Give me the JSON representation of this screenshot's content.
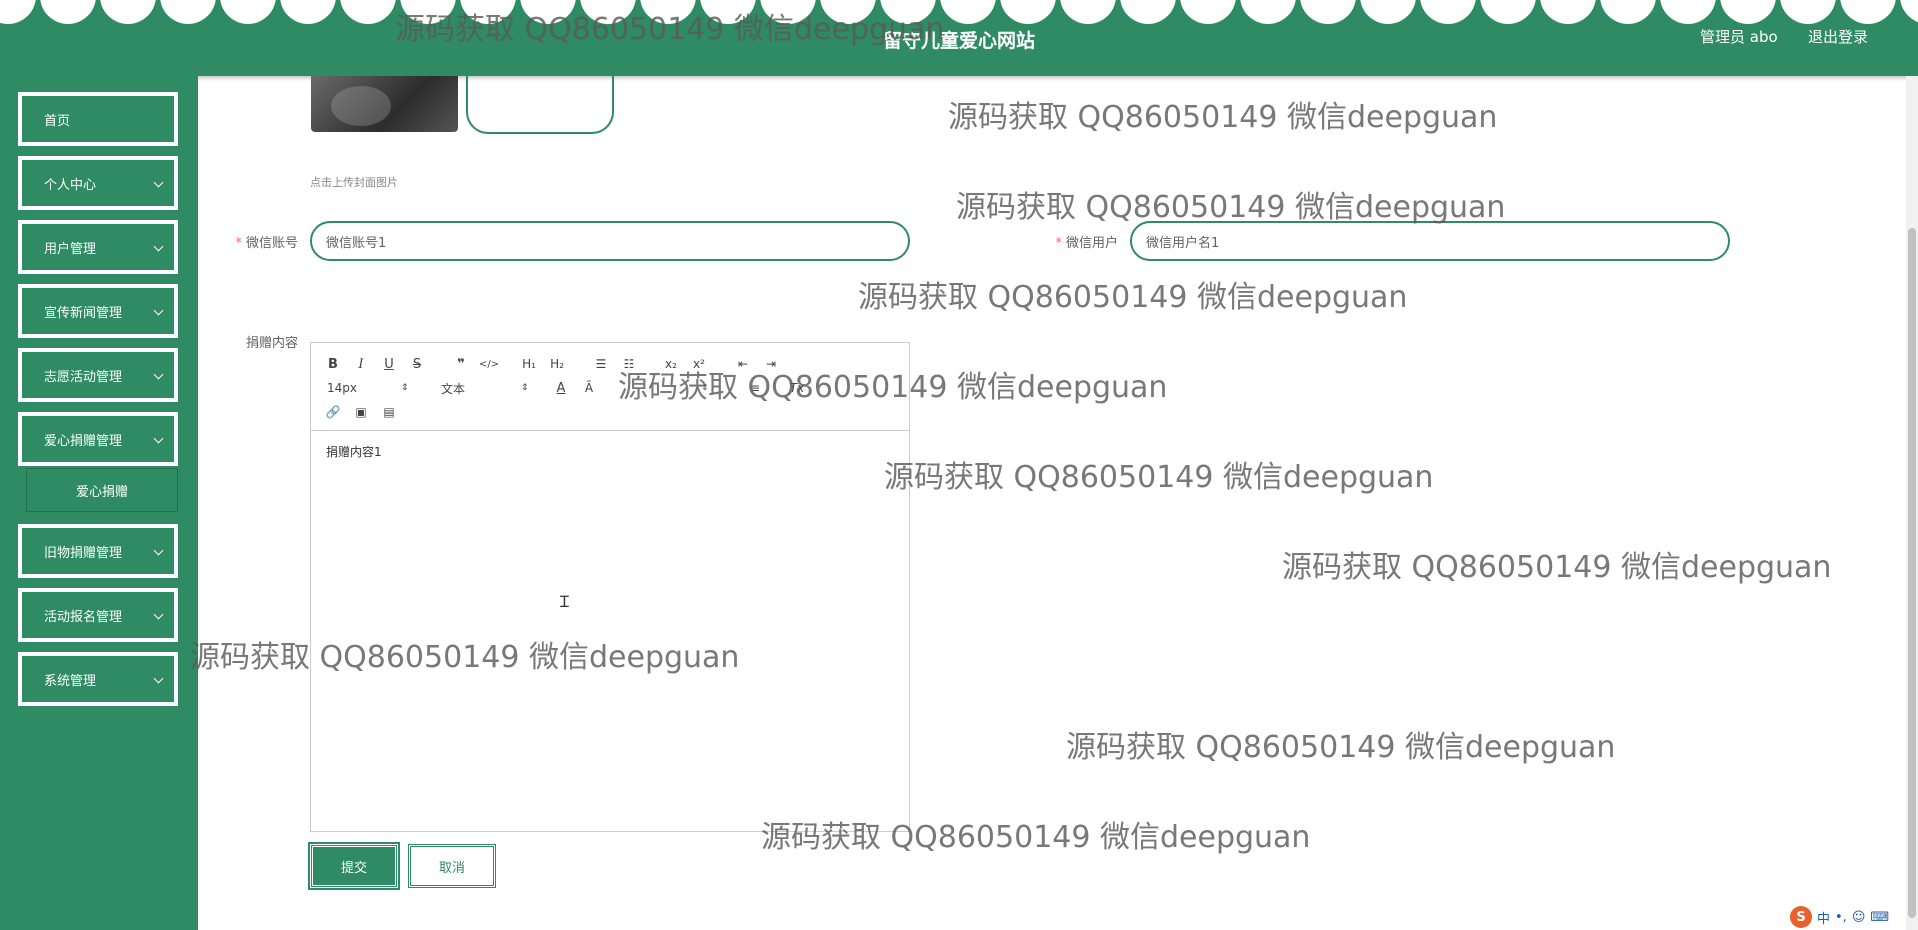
{
  "header": {
    "site_title": "留守儿童爱心网站",
    "user_label": "管理员 abo",
    "logout_label": "退出登录"
  },
  "sidebar": {
    "items": [
      {
        "label": "首页",
        "has_arrow": false
      },
      {
        "label": "个人中心",
        "has_arrow": true
      },
      {
        "label": "用户管理",
        "has_arrow": true
      },
      {
        "label": "宣传新闻管理",
        "has_arrow": true
      },
      {
        "label": "志愿活动管理",
        "has_arrow": true
      },
      {
        "label": "爱心捐赠管理",
        "has_arrow": true
      },
      {
        "label": "旧物捐赠管理",
        "has_arrow": true
      },
      {
        "label": "活动报名管理",
        "has_arrow": true
      },
      {
        "label": "系统管理",
        "has_arrow": true
      }
    ],
    "submenu": {
      "label": "爱心捐赠"
    }
  },
  "form": {
    "upload_tip": "点击上传封面图片",
    "wechat_account": {
      "label": "微信账号",
      "value": "微信账号1",
      "required": true
    },
    "wechat_user": {
      "label": "微信用户",
      "value": "微信用户名1",
      "required": true
    },
    "content": {
      "label": "捐赠内容",
      "value": "捐赠内容1",
      "font_size_select": "14px",
      "text_type_select": "文本"
    },
    "submit_label": "提交",
    "cancel_label": "取消"
  },
  "toolbar_icons": [
    "bold-icon",
    "italic-icon",
    "underline-icon",
    "strike-icon",
    "blockquote-icon",
    "code-block-icon",
    "header-1-icon",
    "header-2-icon",
    "ordered-list-icon",
    "bullet-list-icon",
    "subscript-icon",
    "superscript-icon",
    "outdent-icon",
    "indent-icon",
    "font-color-icon",
    "background-color-icon",
    "align-icon",
    "clean-format-icon",
    "link-icon",
    "image-icon",
    "video-icon"
  ],
  "watermark": {
    "text": "源码获取 QQ86050149 微信deepguan"
  },
  "ime": {
    "logo": "S",
    "mode": "中"
  },
  "colors": {
    "primary": "#2e8b63",
    "white": "#ffffff",
    "required": "#f56c6c"
  }
}
